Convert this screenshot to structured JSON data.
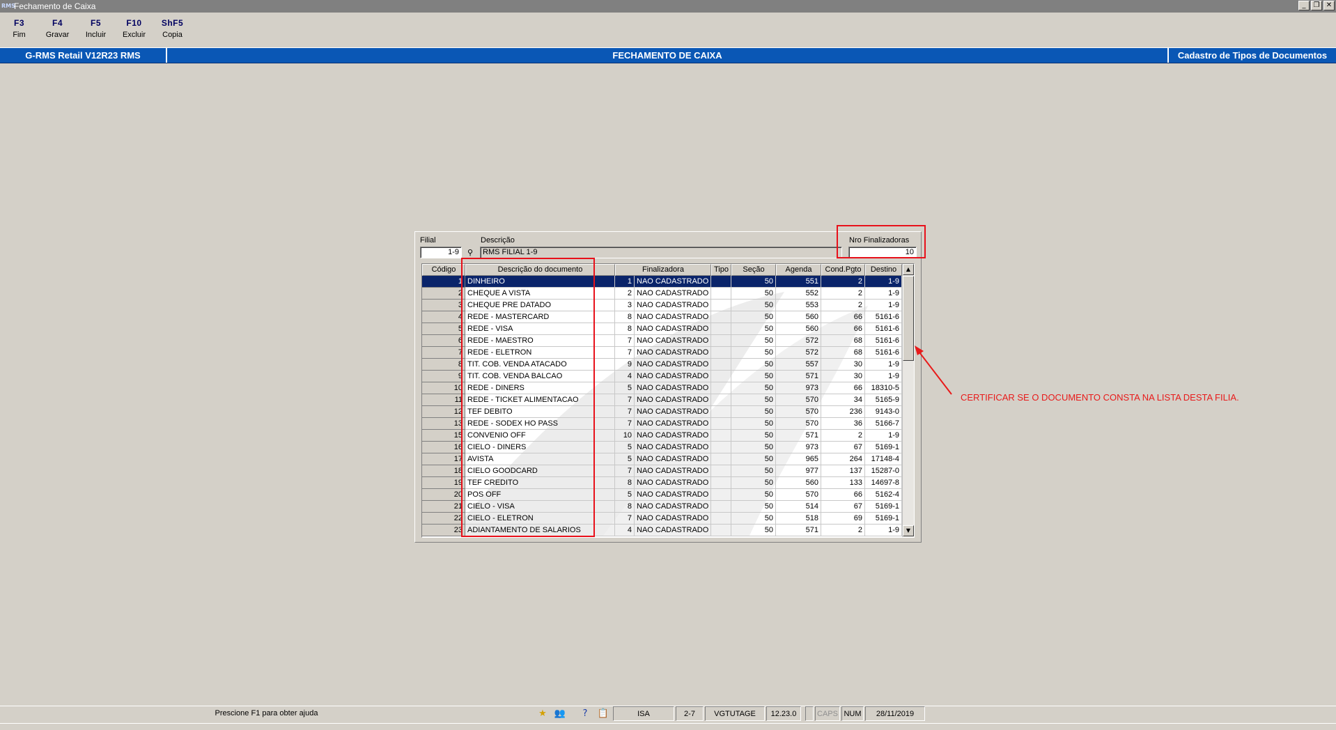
{
  "window": {
    "title": "Fechamento de Caixa",
    "icon": "rms-app-icon",
    "controls": [
      "_",
      "❐",
      "✕"
    ]
  },
  "toolbar": [
    {
      "key": "F3",
      "label": "Fim"
    },
    {
      "key": "F4",
      "label": "Gravar"
    },
    {
      "key": "F5",
      "label": "Incluir"
    },
    {
      "key": "F10",
      "label": "Excluir"
    },
    {
      "key": "ShF5",
      "label": "Copia"
    }
  ],
  "header": {
    "left": "G-RMS Retail V12R23 RMS",
    "center": "FECHAMENTO DE CAIXA",
    "right": "Cadastro de Tipos de Documentos"
  },
  "form": {
    "filial_label": "Filial",
    "filial_value": "1-9",
    "descricao_label": "Descrição",
    "descricao_value": "RMS FILIAL 1-9",
    "nro_label": "Nro Finalizadoras",
    "nro_value": "10",
    "search_icon": "binoculars-icon"
  },
  "grid": {
    "columns": [
      "Código",
      "Descrição do documento",
      "Finalizadora",
      "Tipo",
      "Seção",
      "Agenda",
      "Cond.Pgto",
      "Destino"
    ],
    "rows": [
      {
        "codigo": "1",
        "descricao": "DINHEIRO",
        "fin_num": "1",
        "fin_desc": "NAO CADASTRADO",
        "tipo": "",
        "secao": "50",
        "agenda": "551",
        "cond": "2",
        "destino": "1-9"
      },
      {
        "codigo": "2",
        "descricao": "CHEQUE A VISTA",
        "fin_num": "2",
        "fin_desc": "NAO CADASTRADO",
        "tipo": "",
        "secao": "50",
        "agenda": "552",
        "cond": "2",
        "destino": "1-9"
      },
      {
        "codigo": "3",
        "descricao": "CHEQUE PRE DATADO",
        "fin_num": "3",
        "fin_desc": "NAO CADASTRADO",
        "tipo": "",
        "secao": "50",
        "agenda": "553",
        "cond": "2",
        "destino": "1-9"
      },
      {
        "codigo": "4",
        "descricao": "REDE - MASTERCARD",
        "fin_num": "8",
        "fin_desc": "NAO CADASTRADO",
        "tipo": "",
        "secao": "50",
        "agenda": "560",
        "cond": "66",
        "destino": "5161-6"
      },
      {
        "codigo": "5",
        "descricao": "REDE - VISA",
        "fin_num": "8",
        "fin_desc": "NAO CADASTRADO",
        "tipo": "",
        "secao": "50",
        "agenda": "560",
        "cond": "66",
        "destino": "5161-6"
      },
      {
        "codigo": "6",
        "descricao": "REDE - MAESTRO",
        "fin_num": "7",
        "fin_desc": "NAO CADASTRADO",
        "tipo": "",
        "secao": "50",
        "agenda": "572",
        "cond": "68",
        "destino": "5161-6"
      },
      {
        "codigo": "7",
        "descricao": "REDE - ELETRON",
        "fin_num": "7",
        "fin_desc": "NAO CADASTRADO",
        "tipo": "",
        "secao": "50",
        "agenda": "572",
        "cond": "68",
        "destino": "5161-6"
      },
      {
        "codigo": "8",
        "descricao": "TIT. COB. VENDA ATACADO",
        "fin_num": "9",
        "fin_desc": "NAO CADASTRADO",
        "tipo": "",
        "secao": "50",
        "agenda": "557",
        "cond": "30",
        "destino": "1-9"
      },
      {
        "codigo": "9",
        "descricao": "TIT. COB. VENDA BALCAO",
        "fin_num": "4",
        "fin_desc": "NAO CADASTRADO",
        "tipo": "",
        "secao": "50",
        "agenda": "571",
        "cond": "30",
        "destino": "1-9"
      },
      {
        "codigo": "10",
        "descricao": "REDE - DINERS",
        "fin_num": "5",
        "fin_desc": "NAO CADASTRADO",
        "tipo": "",
        "secao": "50",
        "agenda": "973",
        "cond": "66",
        "destino": "18310-5"
      },
      {
        "codigo": "11",
        "descricao": "REDE - TICKET ALIMENTACAO",
        "fin_num": "7",
        "fin_desc": "NAO CADASTRADO",
        "tipo": "",
        "secao": "50",
        "agenda": "570",
        "cond": "34",
        "destino": "5165-9"
      },
      {
        "codigo": "12",
        "descricao": "TEF DEBITO",
        "fin_num": "7",
        "fin_desc": "NAO CADASTRADO",
        "tipo": "",
        "secao": "50",
        "agenda": "570",
        "cond": "236",
        "destino": "9143-0"
      },
      {
        "codigo": "13",
        "descricao": "REDE - SODEX HO PASS",
        "fin_num": "7",
        "fin_desc": "NAO CADASTRADO",
        "tipo": "",
        "secao": "50",
        "agenda": "570",
        "cond": "36",
        "destino": "5166-7"
      },
      {
        "codigo": "15",
        "descricao": "CONVENIO OFF",
        "fin_num": "10",
        "fin_desc": "NAO CADASTRADO",
        "tipo": "",
        "secao": "50",
        "agenda": "571",
        "cond": "2",
        "destino": "1-9"
      },
      {
        "codigo": "16",
        "descricao": "CIELO - DINERS",
        "fin_num": "5",
        "fin_desc": "NAO CADASTRADO",
        "tipo": "",
        "secao": "50",
        "agenda": "973",
        "cond": "67",
        "destino": "5169-1"
      },
      {
        "codigo": "17",
        "descricao": "AVISTA",
        "fin_num": "5",
        "fin_desc": "NAO CADASTRADO",
        "tipo": "",
        "secao": "50",
        "agenda": "965",
        "cond": "264",
        "destino": "17148-4"
      },
      {
        "codigo": "18",
        "descricao": "CIELO GOODCARD",
        "fin_num": "7",
        "fin_desc": "NAO CADASTRADO",
        "tipo": "",
        "secao": "50",
        "agenda": "977",
        "cond": "137",
        "destino": "15287-0"
      },
      {
        "codigo": "19",
        "descricao": "TEF CREDITO",
        "fin_num": "8",
        "fin_desc": "NAO CADASTRADO",
        "tipo": "",
        "secao": "50",
        "agenda": "560",
        "cond": "133",
        "destino": "14697-8"
      },
      {
        "codigo": "20",
        "descricao": "POS OFF",
        "fin_num": "5",
        "fin_desc": "NAO CADASTRADO",
        "tipo": "",
        "secao": "50",
        "agenda": "570",
        "cond": "66",
        "destino": "5162-4"
      },
      {
        "codigo": "21",
        "descricao": "CIELO - VISA",
        "fin_num": "8",
        "fin_desc": "NAO CADASTRADO",
        "tipo": "",
        "secao": "50",
        "agenda": "514",
        "cond": "67",
        "destino": "5169-1"
      },
      {
        "codigo": "22",
        "descricao": "CIELO - ELETRON",
        "fin_num": "7",
        "fin_desc": "NAO CADASTRADO",
        "tipo": "",
        "secao": "50",
        "agenda": "518",
        "cond": "69",
        "destino": "5169-1"
      },
      {
        "codigo": "23",
        "descricao": "ADIANTAMENTO DE SALARIOS",
        "fin_num": "4",
        "fin_desc": "NAO CADASTRADO",
        "tipo": "",
        "secao": "50",
        "agenda": "571",
        "cond": "2",
        "destino": "1-9"
      }
    ],
    "selected_row": 0,
    "scroll_up": "▲",
    "scroll_down": "▼"
  },
  "annotation": {
    "text": "CERTIFICAR SE O DOCUMENTO CONSTA NA LISTA DESTA FILIA.",
    "color": "#e81a1a"
  },
  "statusbar": {
    "message": "Prescione F1 para obter ajuda",
    "icons": [
      "star-icon",
      "users-icon",
      "help-icon",
      "clipboard-icon"
    ],
    "cells": [
      "ISA",
      "2-7",
      "VGTUTAGE",
      "12.23.0",
      "",
      "CAPS",
      "NUM",
      "28/11/2019"
    ]
  },
  "colors": {
    "header_blue": "#0a57b5",
    "selection": "#0a246a",
    "face": "#d4d0c8"
  }
}
